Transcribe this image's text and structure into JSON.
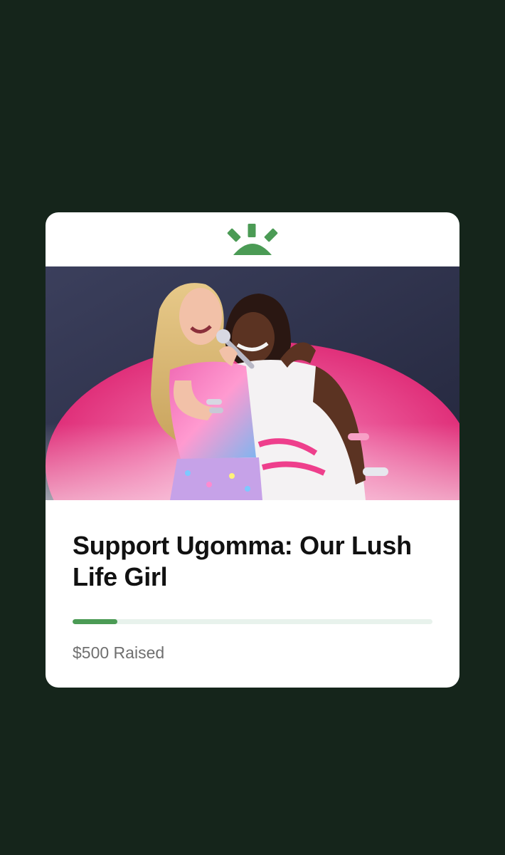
{
  "fundraiser": {
    "brand_icon": "sunrise-logo-icon",
    "image_alt": "Performer singing on stage while hugging a fan",
    "title": "Support Ugomma: Our Lush Life Girl",
    "raised_label": "$500 Raised",
    "progress_fraction": 0.125
  },
  "colors": {
    "background": "#15251b",
    "card": "#ffffff",
    "brand_green": "#4b9b55",
    "progress_track": "#e8f2ec",
    "title_text": "#111111",
    "raised_text": "#6f6f6f",
    "stage_pink": "#e8357a"
  }
}
